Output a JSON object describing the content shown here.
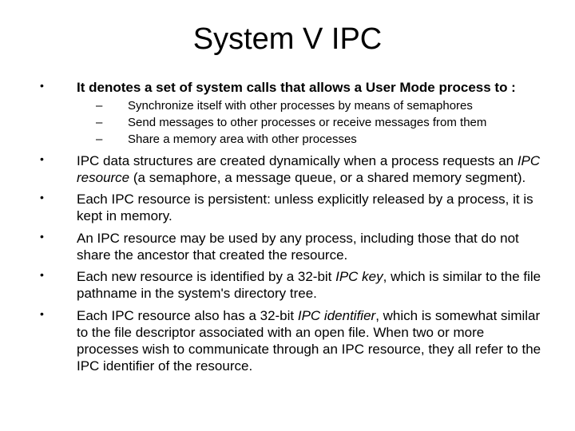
{
  "title": "System V IPC",
  "b1": "It denotes a set of system calls that allows a User Mode process to :",
  "s1": "Synchronize itself with other processes by means of semaphores",
  "s2": "Send messages to other processes or receive messages from them",
  "s3": "Share a memory area with other processes",
  "b2a": "IPC data structures are created dynamically when a process requests an ",
  "b2b": "IPC resource",
  "b2c": " (a semaphore, a message queue, or a shared memory segment).",
  "b3": "Each IPC resource is persistent: unless explicitly released by a process, it is kept in memory.",
  "b4": "An IPC resource may be used by any process, including those that do not share the ancestor that created the resource.",
  "b5a": "Each new resource is identified by a 32-bit ",
  "b5b": "IPC key",
  "b5c": ", which is similar to the file pathname in the system's directory tree.",
  "b6a": "Each IPC resource also has a 32-bit ",
  "b6b": "IPC identifier",
  "b6c": ", which is somewhat similar to the file descriptor associated with an open file. When two or more processes wish to communicate through an IPC resource, they all refer to the IPC identifier of the resource."
}
